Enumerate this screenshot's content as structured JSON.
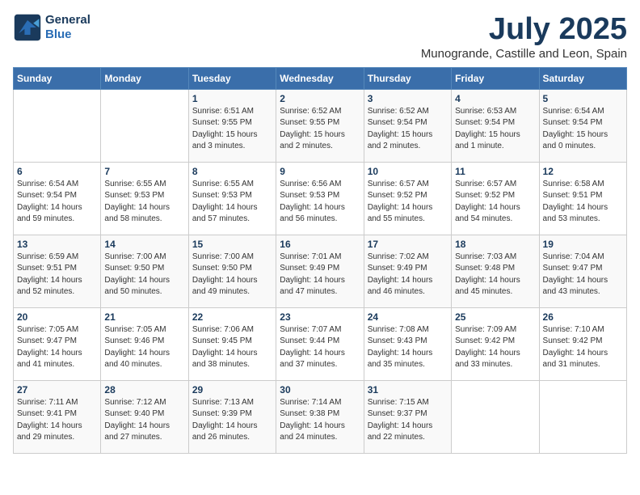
{
  "header": {
    "logo_line1": "General",
    "logo_line2": "Blue",
    "month": "July 2025",
    "location": "Munogrande, Castille and Leon, Spain"
  },
  "weekdays": [
    "Sunday",
    "Monday",
    "Tuesday",
    "Wednesday",
    "Thursday",
    "Friday",
    "Saturday"
  ],
  "weeks": [
    [
      {
        "day": "",
        "info": ""
      },
      {
        "day": "",
        "info": ""
      },
      {
        "day": "1",
        "info": "Sunrise: 6:51 AM\nSunset: 9:55 PM\nDaylight: 15 hours and 3 minutes."
      },
      {
        "day": "2",
        "info": "Sunrise: 6:52 AM\nSunset: 9:55 PM\nDaylight: 15 hours and 2 minutes."
      },
      {
        "day": "3",
        "info": "Sunrise: 6:52 AM\nSunset: 9:54 PM\nDaylight: 15 hours and 2 minutes."
      },
      {
        "day": "4",
        "info": "Sunrise: 6:53 AM\nSunset: 9:54 PM\nDaylight: 15 hours and 1 minute."
      },
      {
        "day": "5",
        "info": "Sunrise: 6:54 AM\nSunset: 9:54 PM\nDaylight: 15 hours and 0 minutes."
      }
    ],
    [
      {
        "day": "6",
        "info": "Sunrise: 6:54 AM\nSunset: 9:54 PM\nDaylight: 14 hours and 59 minutes."
      },
      {
        "day": "7",
        "info": "Sunrise: 6:55 AM\nSunset: 9:53 PM\nDaylight: 14 hours and 58 minutes."
      },
      {
        "day": "8",
        "info": "Sunrise: 6:55 AM\nSunset: 9:53 PM\nDaylight: 14 hours and 57 minutes."
      },
      {
        "day": "9",
        "info": "Sunrise: 6:56 AM\nSunset: 9:53 PM\nDaylight: 14 hours and 56 minutes."
      },
      {
        "day": "10",
        "info": "Sunrise: 6:57 AM\nSunset: 9:52 PM\nDaylight: 14 hours and 55 minutes."
      },
      {
        "day": "11",
        "info": "Sunrise: 6:57 AM\nSunset: 9:52 PM\nDaylight: 14 hours and 54 minutes."
      },
      {
        "day": "12",
        "info": "Sunrise: 6:58 AM\nSunset: 9:51 PM\nDaylight: 14 hours and 53 minutes."
      }
    ],
    [
      {
        "day": "13",
        "info": "Sunrise: 6:59 AM\nSunset: 9:51 PM\nDaylight: 14 hours and 52 minutes."
      },
      {
        "day": "14",
        "info": "Sunrise: 7:00 AM\nSunset: 9:50 PM\nDaylight: 14 hours and 50 minutes."
      },
      {
        "day": "15",
        "info": "Sunrise: 7:00 AM\nSunset: 9:50 PM\nDaylight: 14 hours and 49 minutes."
      },
      {
        "day": "16",
        "info": "Sunrise: 7:01 AM\nSunset: 9:49 PM\nDaylight: 14 hours and 47 minutes."
      },
      {
        "day": "17",
        "info": "Sunrise: 7:02 AM\nSunset: 9:49 PM\nDaylight: 14 hours and 46 minutes."
      },
      {
        "day": "18",
        "info": "Sunrise: 7:03 AM\nSunset: 9:48 PM\nDaylight: 14 hours and 45 minutes."
      },
      {
        "day": "19",
        "info": "Sunrise: 7:04 AM\nSunset: 9:47 PM\nDaylight: 14 hours and 43 minutes."
      }
    ],
    [
      {
        "day": "20",
        "info": "Sunrise: 7:05 AM\nSunset: 9:47 PM\nDaylight: 14 hours and 41 minutes."
      },
      {
        "day": "21",
        "info": "Sunrise: 7:05 AM\nSunset: 9:46 PM\nDaylight: 14 hours and 40 minutes."
      },
      {
        "day": "22",
        "info": "Sunrise: 7:06 AM\nSunset: 9:45 PM\nDaylight: 14 hours and 38 minutes."
      },
      {
        "day": "23",
        "info": "Sunrise: 7:07 AM\nSunset: 9:44 PM\nDaylight: 14 hours and 37 minutes."
      },
      {
        "day": "24",
        "info": "Sunrise: 7:08 AM\nSunset: 9:43 PM\nDaylight: 14 hours and 35 minutes."
      },
      {
        "day": "25",
        "info": "Sunrise: 7:09 AM\nSunset: 9:42 PM\nDaylight: 14 hours and 33 minutes."
      },
      {
        "day": "26",
        "info": "Sunrise: 7:10 AM\nSunset: 9:42 PM\nDaylight: 14 hours and 31 minutes."
      }
    ],
    [
      {
        "day": "27",
        "info": "Sunrise: 7:11 AM\nSunset: 9:41 PM\nDaylight: 14 hours and 29 minutes."
      },
      {
        "day": "28",
        "info": "Sunrise: 7:12 AM\nSunset: 9:40 PM\nDaylight: 14 hours and 27 minutes."
      },
      {
        "day": "29",
        "info": "Sunrise: 7:13 AM\nSunset: 9:39 PM\nDaylight: 14 hours and 26 minutes."
      },
      {
        "day": "30",
        "info": "Sunrise: 7:14 AM\nSunset: 9:38 PM\nDaylight: 14 hours and 24 minutes."
      },
      {
        "day": "31",
        "info": "Sunrise: 7:15 AM\nSunset: 9:37 PM\nDaylight: 14 hours and 22 minutes."
      },
      {
        "day": "",
        "info": ""
      },
      {
        "day": "",
        "info": ""
      }
    ]
  ]
}
